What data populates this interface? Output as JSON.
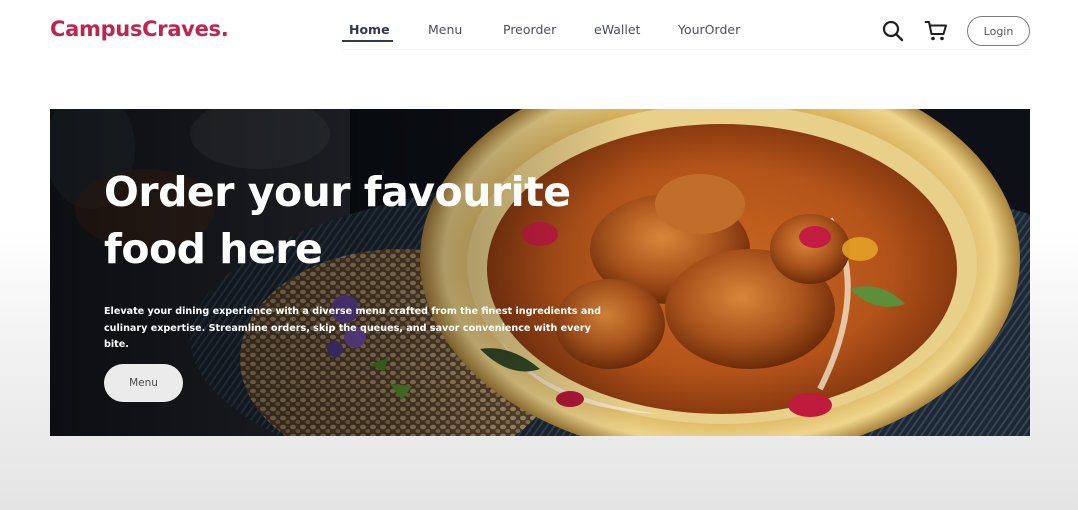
{
  "brand": {
    "name": "CampusCraves.",
    "color": "#c0254d"
  },
  "nav": {
    "items": [
      {
        "label": "Home",
        "active": true
      },
      {
        "label": "Menu",
        "active": false
      },
      {
        "label": "Preorder",
        "active": false
      },
      {
        "label": "eWallet",
        "active": false
      },
      {
        "label": "YourOrder",
        "active": false
      }
    ]
  },
  "header_actions": {
    "search_icon": "search-icon",
    "cart_icon": "cart-icon",
    "login_label": "Login"
  },
  "hero": {
    "title": "Order your favourite food here",
    "description": "Elevate your dining experience with a diverse menu crafted from the finest ingredients and culinary expertise. Streamline orders, skip the queues, and savor convenience with every bite.",
    "button_label": "Menu",
    "image": "curry-bowl-food-photo"
  }
}
